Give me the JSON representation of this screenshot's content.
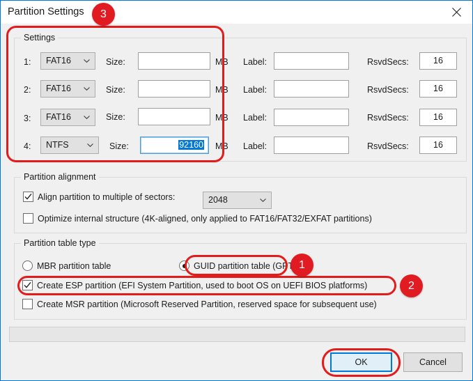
{
  "window": {
    "title": "Partition Settings",
    "close_label": "✕"
  },
  "settings_group": {
    "title": "Settings",
    "size_label": "Size:",
    "mb_label": "MB",
    "label_label": "Label:",
    "rsvdsecs_label": "RsvdSecs:",
    "rows": [
      {
        "index": "1:",
        "fs": "FAT16",
        "size": "",
        "label": "",
        "rsvdsecs": "16"
      },
      {
        "index": "2:",
        "fs": "FAT16",
        "size": "",
        "label": "",
        "rsvdsecs": "16"
      },
      {
        "index": "3:",
        "fs": "FAT16",
        "size": "",
        "label": "",
        "rsvdsecs": "16"
      },
      {
        "index": "4:",
        "fs": "NTFS",
        "size": "92160",
        "label": "",
        "rsvdsecs": "16"
      }
    ]
  },
  "alignment_group": {
    "title": "Partition alignment",
    "align_checkbox": {
      "label": "Align partition to multiple of sectors:",
      "checked": true
    },
    "sectors_value": "2048",
    "optimize_checkbox": {
      "label": "Optimize internal structure (4K-aligned, only applied to FAT16/FAT32/EXFAT partitions)",
      "checked": false
    }
  },
  "table_type_group": {
    "title": "Partition table type",
    "mbr_radio": {
      "label": "MBR partition table",
      "selected": false
    },
    "gpt_radio": {
      "label": "GUID partition table (GPT)",
      "selected": true
    },
    "esp_checkbox": {
      "label": "Create ESP partition (EFI System Partition, used to boot OS on UEFI BIOS platforms)",
      "checked": true
    },
    "msr_checkbox": {
      "label": "Create MSR partition (Microsoft Reserved Partition, reserved space for subsequent use)",
      "checked": false
    }
  },
  "footer": {
    "ok_label": "OK",
    "cancel_label": "Cancel"
  },
  "annotations": {
    "badge_1": "1",
    "badge_2": "2",
    "badge_3": "3"
  },
  "colors": {
    "accent": "#0078d7",
    "annotation_red": "#e01b22",
    "dialog_bg": "#f0f0f0"
  }
}
